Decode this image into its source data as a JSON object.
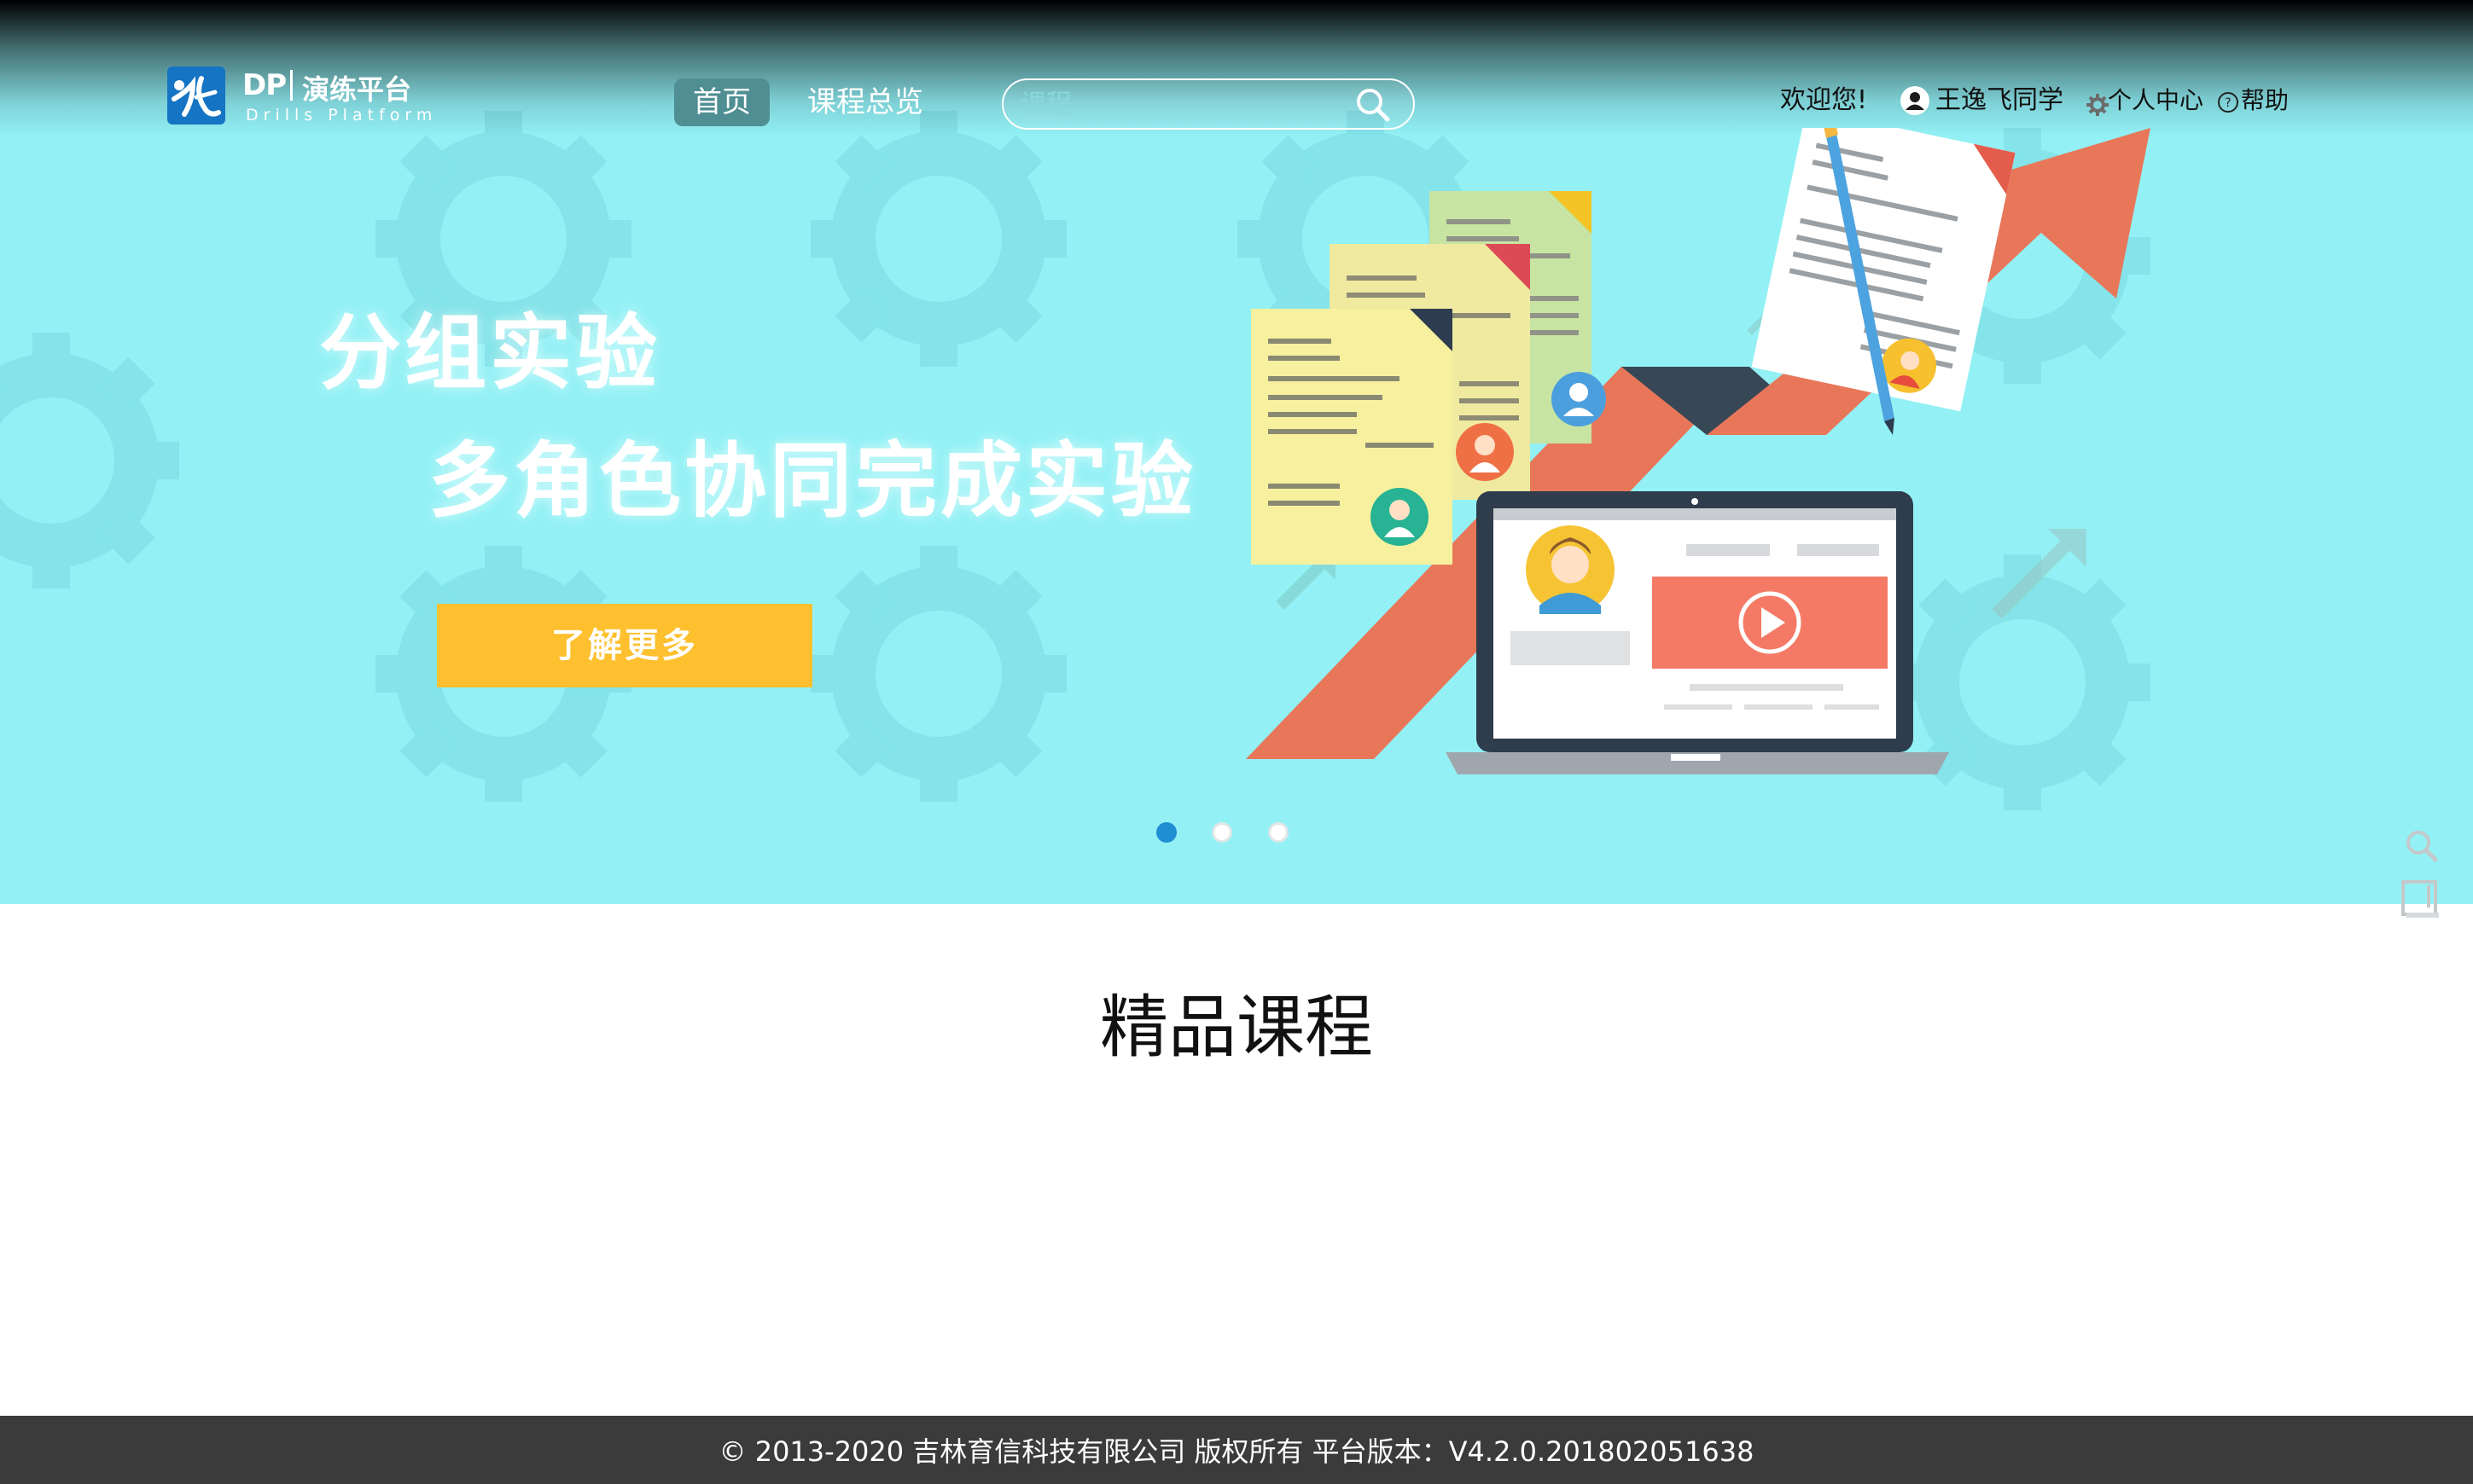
{
  "header": {
    "logo": {
      "short": "DP",
      "name": "演练平台",
      "subtitle": "Drills Platform"
    },
    "nav": {
      "home": "首页",
      "courses": "课程总览"
    },
    "search": {
      "placeholder": "课程"
    },
    "user": {
      "welcome": "欢迎您!",
      "name": "王逸飞同学",
      "profile": "个人中心",
      "help": "帮助"
    }
  },
  "banner": {
    "headline_1": "分组实验",
    "headline_2": "多角色协同完成实验",
    "button": "了解更多",
    "slides": 3,
    "active_slide": 1,
    "colors": {
      "background": "#93f1f5",
      "button": "#fec02e",
      "arrow": "#e8775a",
      "video": "#f47a65"
    }
  },
  "section": {
    "title": "精品课程"
  },
  "footer": {
    "text": "© 2013-2020 吉林育信科技有限公司 版权所有 平台版本：V4.2.0.201802051638"
  },
  "icons": [
    "logo-icon",
    "search-icon",
    "user-icon",
    "gear-icon",
    "help-icon",
    "play-icon",
    "float-search-icon",
    "float-book-icon"
  ]
}
